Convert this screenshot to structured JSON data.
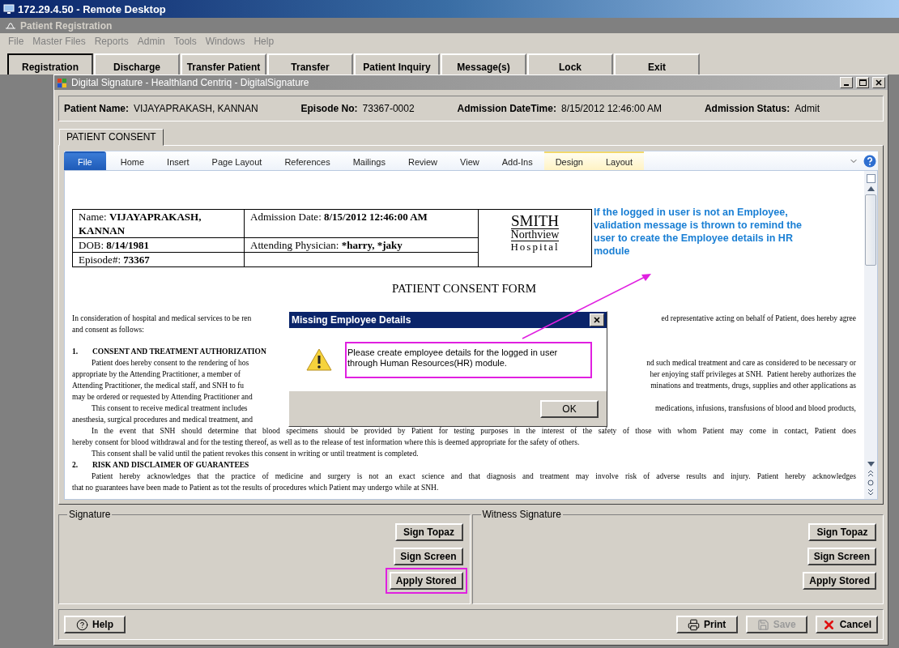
{
  "remote_desktop": {
    "title": "172.29.4.50 - Remote Desktop"
  },
  "app": {
    "title": "Patient Registration",
    "menu": [
      "File",
      "Master Files",
      "Reports",
      "Admin",
      "Tools",
      "Windows",
      "Help"
    ],
    "toolbar": [
      {
        "label": "Registration",
        "selected": true
      },
      {
        "label": "Discharge",
        "selected": false
      },
      {
        "label": "Transfer Patient",
        "selected": false
      },
      {
        "label": "Transfer",
        "selected": false
      },
      {
        "label": "Patient Inquiry",
        "selected": false
      },
      {
        "label": "Message(s)",
        "selected": false
      },
      {
        "label": "Lock",
        "selected": false
      },
      {
        "label": "Exit",
        "selected": false
      }
    ]
  },
  "signature_window": {
    "title": "Digital Signature - Healthland Centriq - DigitalSignature",
    "patient": [
      {
        "label": "Patient Name:",
        "value": "VIJAYAPRAKASH, KANNAN"
      },
      {
        "label": "Episode No:",
        "value": "73367-0002"
      },
      {
        "label": "Admission DateTime:",
        "value": "8/15/2012 12:46:00 AM"
      },
      {
        "label": "Admission Status:",
        "value": "Admit"
      }
    ],
    "tabs": [
      {
        "label": "PATIENT CONSENT",
        "selected": true
      }
    ],
    "ribbon": [
      {
        "label": "File",
        "selected": true,
        "contextual": false
      },
      {
        "label": "Home",
        "selected": false,
        "contextual": false
      },
      {
        "label": "Insert",
        "selected": false,
        "contextual": false
      },
      {
        "label": "Page Layout",
        "selected": false,
        "contextual": false
      },
      {
        "label": "References",
        "selected": false,
        "contextual": false
      },
      {
        "label": "Mailings",
        "selected": false,
        "contextual": false
      },
      {
        "label": "Review",
        "selected": false,
        "contextual": false
      },
      {
        "label": "View",
        "selected": false,
        "contextual": false
      },
      {
        "label": "Add-Ins",
        "selected": false,
        "contextual": false
      },
      {
        "label": "Design",
        "selected": false,
        "contextual": true
      },
      {
        "label": "Layout",
        "selected": false,
        "contextual": true
      }
    ],
    "document": {
      "info_table": [
        [
          {
            "label": "Name:",
            "value": "VIJAYAPRAKASH, KANNAN"
          },
          {
            "label": "Admission Date:",
            "value": "8/15/2012 12:46:00 AM"
          }
        ],
        [
          {
            "label": "DOB:",
            "value": "8/14/1981"
          },
          {
            "label": "Attending Physician:",
            "value": "*harry, *jaky"
          }
        ],
        [
          {
            "label": "Episode#:",
            "value": "73367"
          }
        ]
      ],
      "logo": [
        "SMITH",
        "Northview",
        "Hospital"
      ],
      "title": "PATIENT CONSENT FORM",
      "lines": [
        {
          "kind": "intro",
          "left": "In consideration of hospital and medical services to be ren",
          "right": "ed representative acting on behalf of Patient, does hereby agree"
        },
        {
          "kind": "intro",
          "left": "and consent as follows:"
        },
        {
          "kind": "heading",
          "number": "1.",
          "left": "CONSENT AND TREATMENT AUTHORIZATION"
        },
        {
          "kind": "first",
          "left": "Patient does hereby consent to the rendering of hos",
          "right": "nd such medical treatment and care as considered to be necessary or"
        },
        {
          "kind": "cont",
          "left": "appropriate by the Attending Practitioner, a member of",
          "right": "her enjoying staff privileges at SNH.  Patient hereby authorizes the"
        },
        {
          "kind": "cont",
          "left": "Attending Practitioner, the medical staff, and SNH to fu",
          "right": "minations and treatments, drugs, supplies and other applications as"
        },
        {
          "kind": "cont",
          "left": "may be ordered or requested by Attending Practitioner and"
        },
        {
          "kind": "first",
          "left": "This consent to receive medical treatment includes",
          "right": "medications, infusions, transfusions of blood and blood products,"
        },
        {
          "kind": "cont",
          "left": "anesthesia, surgical procedures and medical treatment, and"
        },
        {
          "kind": "first_justified",
          "left": "In the event that SNH should determine that blood specimens should be provided by Patient for testing purposes in the interest of the safety of those with whom Patient may come in contact, Patient does"
        },
        {
          "kind": "cont",
          "left": "hereby consent for blood withdrawal and for the testing thereof, as well as to the release of test information where this is deemed appropriate for the safety of others."
        },
        {
          "kind": "first",
          "left": "This consent shall be valid until the patient revokes this consent in writing or until treatment is completed."
        },
        {
          "kind": "heading",
          "number": "2.",
          "left": "RISK AND DISCLAIMER OF GUARANTEES"
        },
        {
          "kind": "first_justified",
          "left": "Patient hereby acknowledges that the practice of medicine and surgery is not an exact science and that diagnosis and treatment may involve risk of adverse results and injury.  Patient hereby acknowledges"
        },
        {
          "kind": "cont",
          "left": "that no guarantees have been made to Patient as tot the results of procedures which Patient may undergo while at SNH."
        }
      ]
    },
    "signature_groups": [
      {
        "title": "Signature",
        "buttons": [
          {
            "label": "Sign Topaz",
            "highlighted": false
          },
          {
            "label": "Sign Screen",
            "highlighted": false
          },
          {
            "label": "Apply Stored",
            "highlighted": true
          }
        ]
      },
      {
        "title": "Witness Signature",
        "buttons": [
          {
            "label": "Sign Topaz",
            "highlighted": false
          },
          {
            "label": "Sign Screen",
            "highlighted": false
          },
          {
            "label": "Apply Stored",
            "highlighted": false
          }
        ]
      }
    ],
    "footer_buttons": [
      {
        "label": "Help",
        "kind": "help",
        "disabled": false
      },
      {
        "label": "Print",
        "kind": "print",
        "disabled": false
      },
      {
        "label": "Save",
        "kind": "save",
        "disabled": true
      },
      {
        "label": "Cancel",
        "kind": "cancel",
        "disabled": false
      }
    ]
  },
  "annotation": {
    "text": "If the logged in user is not an Employee, validation message is thrown to remind the user to create the Employee details in HR module"
  },
  "message_box": {
    "title": "Missing Employee Details",
    "message": "Please create employee details for the logged in user through Human Resources(HR) module.",
    "highlighted": true,
    "buttons": [
      "OK"
    ]
  }
}
